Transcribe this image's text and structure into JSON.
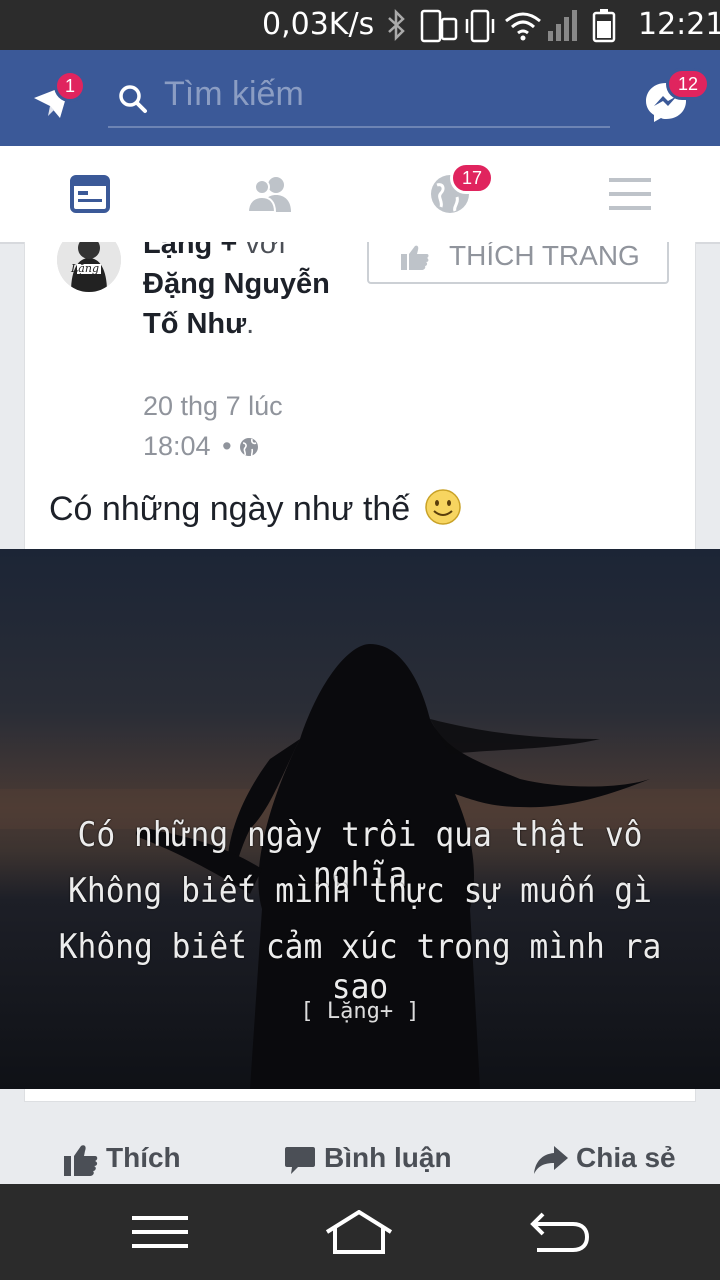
{
  "status_bar": {
    "speed": "0,03K/s",
    "time": "12:21",
    "icons": [
      "bluetooth-icon",
      "phone-icon",
      "vibrate-icon",
      "wifi-icon",
      "signal-icon",
      "battery-icon"
    ]
  },
  "header": {
    "notifications_badge": "1",
    "search_placeholder": "Tìm kiếm",
    "messenger_badge": "12",
    "colors": {
      "brand": "#3b5998",
      "badge": "#e0245e"
    }
  },
  "tabs": [
    {
      "name": "news-feed",
      "icon": "news-feed-icon",
      "active": true
    },
    {
      "name": "friends",
      "icon": "friends-icon"
    },
    {
      "name": "notifications",
      "icon": "globe-icon",
      "badge": "17"
    },
    {
      "name": "menu",
      "icon": "hamburger-icon"
    }
  ],
  "post": {
    "author": "Lặng +",
    "with_word": "với",
    "tagged": "Đặng Nguyễn Tố Như",
    "timestamp": "20 thg 7 lúc 18:04",
    "like_page_label": "THÍCH TRANG",
    "text": "Có những ngày như thế",
    "image_quote": [
      "Có những ngày trôi qua thật vô nghĩa",
      "Không biết mình thực sự muốn gì",
      "Không biết cảm xúc trong mình ra sao"
    ],
    "image_signature": "[ Lặng+ ]",
    "avatar_text": "Lặng"
  },
  "actions": {
    "like": "Thích",
    "comment": "Bình luận",
    "share": "Chia sẻ"
  },
  "navbar": {
    "icons": [
      "menu-icon",
      "home-icon",
      "back-icon"
    ]
  }
}
